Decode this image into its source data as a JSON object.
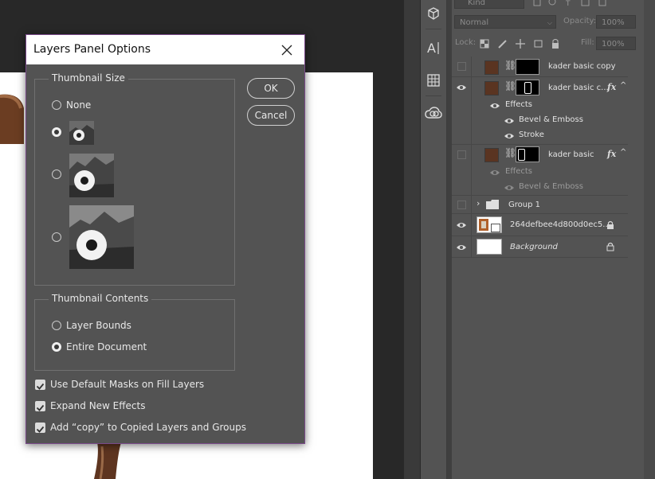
{
  "dialog": {
    "title": "Layers Panel Options",
    "thumbnail_size": {
      "title": "Thumbnail Size",
      "options": [
        {
          "label": "None",
          "selected": false
        },
        {
          "label": "",
          "selected": true
        },
        {
          "label": "",
          "selected": false
        },
        {
          "label": "",
          "selected": false
        }
      ]
    },
    "thumbnail_contents": {
      "title": "Thumbnail Contents",
      "options": [
        {
          "label": "Layer Bounds",
          "selected": false
        },
        {
          "label": "Entire Document",
          "selected": true
        }
      ]
    },
    "checkboxes": [
      {
        "label": "Use Default Masks on Fill Layers",
        "checked": true
      },
      {
        "label": "Expand New Effects",
        "checked": true
      },
      {
        "label": "Add “copy” to Copied Layers and Groups",
        "checked": true
      }
    ],
    "ok_label": "OK",
    "cancel_label": "Cancel"
  },
  "layers_panel": {
    "kind_placeholder": "Kind",
    "blend_mode": "Normal",
    "opacity_label": "Opacity:",
    "opacity_value": "100%",
    "lock_label": "Lock:",
    "fill_label": "Fill:",
    "fill_value": "100%",
    "layers": [
      {
        "name": "kader basic copy",
        "visible": false
      },
      {
        "name": "kader basic c...",
        "visible": true,
        "effects": "Effects",
        "effect_items": [
          "Bevel & Emboss",
          "Stroke"
        ]
      },
      {
        "name": "kader basic",
        "visible": false,
        "effects": "Effects",
        "effect_items": [
          "Bevel & Emboss"
        ]
      },
      {
        "name": "Group 1",
        "visible": false
      },
      {
        "name": "264defbee4d800d0ec5...",
        "visible": true
      },
      {
        "name": "Background",
        "visible": true
      }
    ]
  },
  "colors": {
    "accent_border": "#7a4a8a",
    "panel_bg": "#535353",
    "layer_swatch": "#5a3421"
  }
}
